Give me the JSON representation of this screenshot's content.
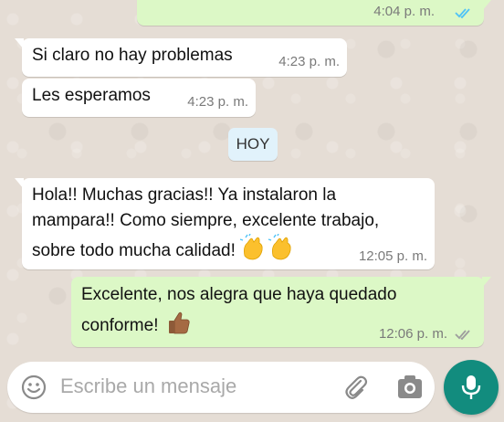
{
  "messages": [
    {
      "id": "m0",
      "direction": "out",
      "text": "",
      "time": "4:04 p. m.",
      "status": "read"
    },
    {
      "id": "m1",
      "direction": "in",
      "text": "Si claro no hay problemas",
      "time": "4:23 p. m."
    },
    {
      "id": "m2",
      "direction": "in",
      "text": "Les esperamos",
      "time": "4:23 p. m."
    },
    {
      "id": "m3",
      "direction": "in",
      "lines": [
        "Hola!! Muchas gracias!! Ya instalaron la",
        "mampara!! Como siempre, excelente trabajo,",
        "sobre todo mucha calidad!"
      ],
      "emoji": "clapping-hands",
      "time": "12:05 p. m."
    },
    {
      "id": "m4",
      "direction": "out",
      "lines": [
        "Excelente, nos alegra que haya quedado",
        "conforme!"
      ],
      "emoji": "thumbs-up",
      "time": "12:06 p. m.",
      "status": "delivered"
    }
  ],
  "date_divider": "HOY",
  "composer": {
    "placeholder": "Escribe un mensaje",
    "icons": [
      "emoji-icon",
      "attach-icon",
      "camera-icon",
      "mic-icon"
    ]
  },
  "colors": {
    "outgoing_bubble": "#dcf8c6",
    "incoming_bubble": "#ffffff",
    "read_ticks": "#4fc3f7",
    "mic_button": "#128c7e",
    "wallpaper": "#e5ddd5"
  }
}
